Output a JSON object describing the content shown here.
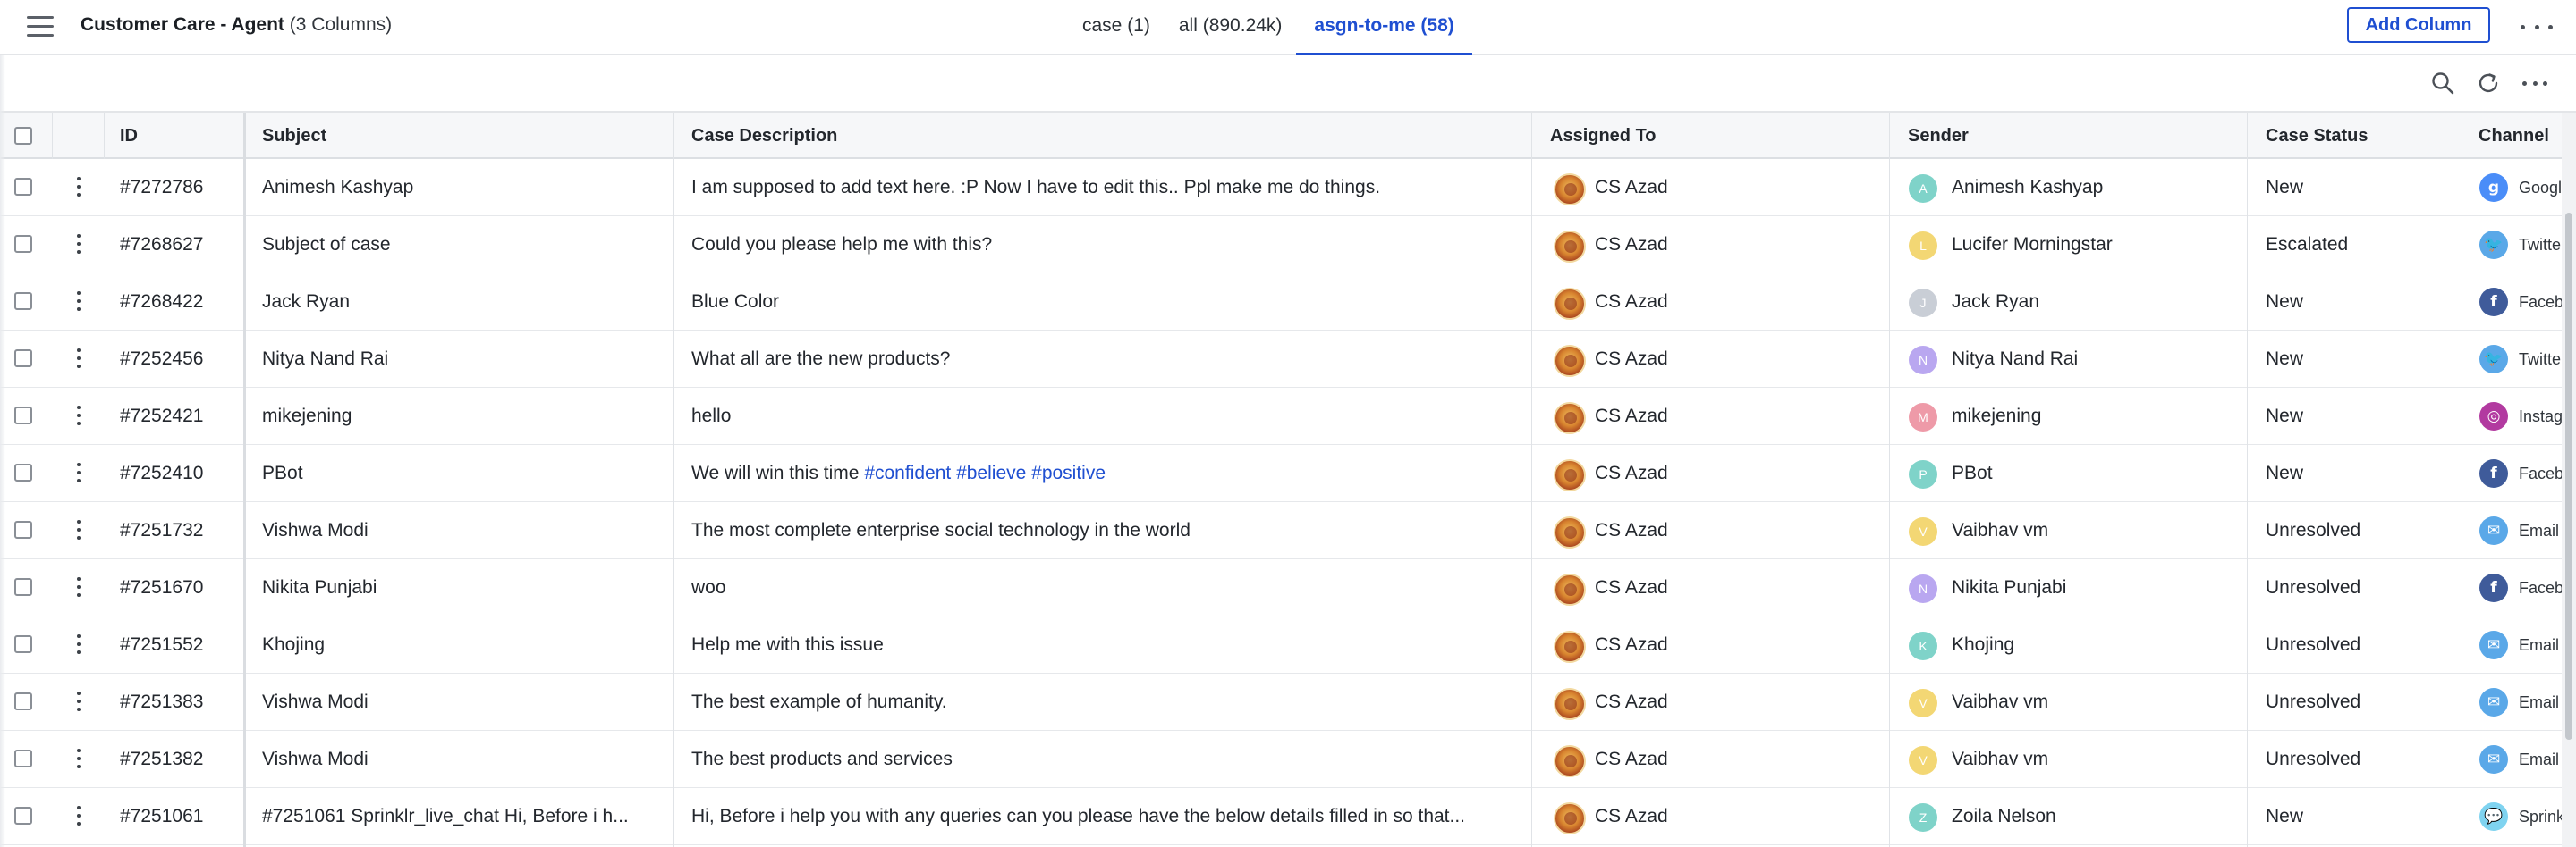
{
  "header": {
    "title": "Customer Care - Agent",
    "subtitle": "(3 Columns)",
    "add_column_label": "Add Column"
  },
  "tabs": [
    {
      "label": "case (1)",
      "active": false
    },
    {
      "label": "all (890.24k)",
      "active": false
    },
    {
      "label": "asgn-to-me (58)",
      "active": true
    }
  ],
  "toolbar": {
    "icons": [
      "search-icon",
      "refresh-icon",
      "more-icon"
    ]
  },
  "columns": {
    "id": "ID",
    "subject": "Subject",
    "description": "Case Description",
    "assigned": "Assigned To",
    "sender": "Sender",
    "status": "Case Status",
    "channel": "Channel"
  },
  "rows": [
    {
      "id": "#7272786",
      "subject": "Animesh Kashyap",
      "description": "I am supposed to add text here. :P Now I have to edit this.. Ppl make me do things.",
      "assigned": "CS Azad",
      "sender": "Animesh Kashyap",
      "sender_initial": "A",
      "sender_color": "#7fd3c9",
      "status": "New",
      "channel": "Google",
      "channel_icon": "google-icon",
      "channel_color": "#4a8df8",
      "channel_glyph": "g"
    },
    {
      "id": "#7268627",
      "subject": "Subject of case",
      "description": "Could you please help me with this?",
      "assigned": "CS Azad",
      "sender": "Lucifer Morningstar",
      "sender_initial": "L",
      "sender_color": "#f3d774",
      "status": "Escalated",
      "channel": "Twitter",
      "channel_icon": "twitter-icon",
      "channel_color": "#5aa8e8",
      "channel_glyph": "🐦"
    },
    {
      "id": "#7268422",
      "subject": "Jack Ryan",
      "description": "Blue Color",
      "assigned": "CS Azad",
      "sender": "Jack Ryan",
      "sender_initial": "J",
      "sender_color": "#c9ced6",
      "status": "New",
      "channel": "Facebook",
      "channel_icon": "facebook-icon",
      "channel_color": "#3f5b9a",
      "channel_glyph": "f"
    },
    {
      "id": "#7252456",
      "subject": "Nitya Nand Rai",
      "description": "What all are the new products?",
      "assigned": "CS Azad",
      "sender": "Nitya Nand Rai",
      "sender_initial": "N",
      "sender_color": "#b9a7f0",
      "status": "New",
      "channel": "Twitter",
      "channel_icon": "twitter-icon",
      "channel_color": "#5aa8e8",
      "channel_glyph": "🐦"
    },
    {
      "id": "#7252421",
      "subject": "mikejening",
      "description": "hello",
      "assigned": "CS Azad",
      "sender": "mikejening",
      "sender_initial": "M",
      "sender_color": "#ee9aa8",
      "status": "New",
      "channel": "Instagram",
      "channel_icon": "instagram-icon",
      "channel_color": "#b23aa0",
      "channel_glyph": "◎"
    },
    {
      "id": "#7252410",
      "subject": "PBot",
      "description": "We will win this time",
      "description_tags": "#confident #believe #positive",
      "assigned": "CS Azad",
      "sender": "PBot",
      "sender_initial": "P",
      "sender_color": "#7fd3c9",
      "status": "New",
      "channel": "Facebook",
      "channel_icon": "facebook-icon",
      "channel_color": "#3f5b9a",
      "channel_glyph": "f"
    },
    {
      "id": "#7251732",
      "subject": "Vishwa Modi",
      "description": "The most complete enterprise social technology in the world",
      "assigned": "CS Azad",
      "sender": "Vaibhav vm",
      "sender_initial": "V",
      "sender_color": "#f3d774",
      "status": "Unresolved",
      "channel": "Email",
      "channel_icon": "email-icon",
      "channel_color": "#5aa8e8",
      "channel_glyph": "✉"
    },
    {
      "id": "#7251670",
      "subject": "Nikita Punjabi",
      "description": "woo",
      "assigned": "CS Azad",
      "sender": "Nikita Punjabi",
      "sender_initial": "N",
      "sender_color": "#b9a7f0",
      "status": "Unresolved",
      "channel": "Facebook",
      "channel_icon": "facebook-icon",
      "channel_color": "#3f5b9a",
      "channel_glyph": "f"
    },
    {
      "id": "#7251552",
      "subject": "Khojing",
      "description": "Help me with this issue",
      "assigned": "CS Azad",
      "sender": "Khojing",
      "sender_initial": "K",
      "sender_color": "#7fd3c9",
      "status": "Unresolved",
      "channel": "Email",
      "channel_icon": "email-icon",
      "channel_color": "#5aa8e8",
      "channel_glyph": "✉"
    },
    {
      "id": "#7251383",
      "subject": "Vishwa Modi",
      "description": "The best example of humanity.",
      "assigned": "CS Azad",
      "sender": "Vaibhav vm",
      "sender_initial": "V",
      "sender_color": "#f3d774",
      "status": "Unresolved",
      "channel": "Email",
      "channel_icon": "email-icon",
      "channel_color": "#5aa8e8",
      "channel_glyph": "✉"
    },
    {
      "id": "#7251382",
      "subject": "Vishwa Modi",
      "description": "The best products and services",
      "assigned": "CS Azad",
      "sender": "Vaibhav vm",
      "sender_initial": "V",
      "sender_color": "#f3d774",
      "status": "Unresolved",
      "channel": "Email",
      "channel_icon": "email-icon",
      "channel_color": "#5aa8e8",
      "channel_glyph": "✉"
    },
    {
      "id": "#7251061",
      "subject": "#7251061 Sprinklr_live_chat Hi, Before i h...",
      "description": "Hi, Before i help you with any queries can you please have the below details filled in so that...",
      "assigned": "CS Azad",
      "sender": "Zoila Nelson",
      "sender_initial": "Z",
      "sender_color": "#7fd3c9",
      "status": "New",
      "channel": "Sprinklr",
      "channel_icon": "sprinklr-chat-icon",
      "channel_color": "#7fd3f0",
      "channel_glyph": "💬"
    }
  ]
}
